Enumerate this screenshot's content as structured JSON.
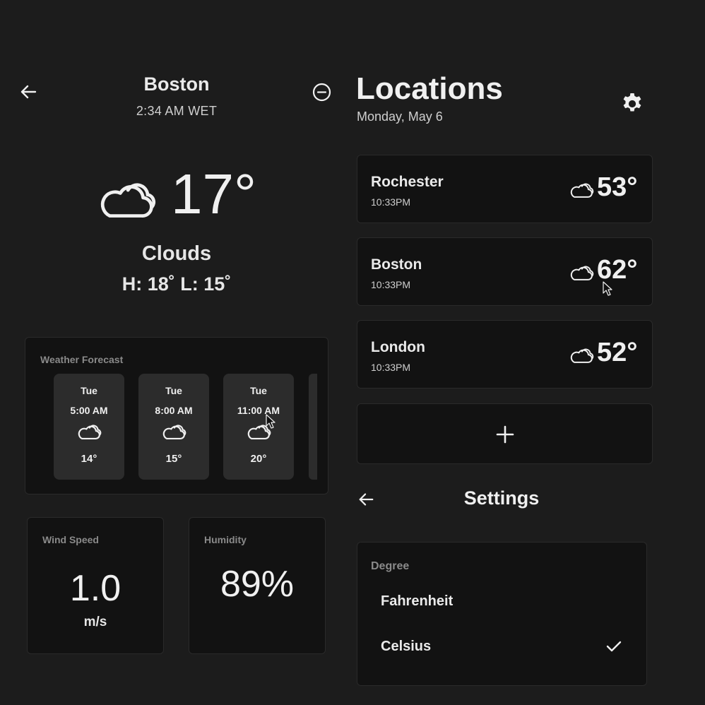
{
  "detail": {
    "city": "Boston",
    "local_time": "2:34 AM WET",
    "temperature": "17°",
    "condition": "Clouds",
    "high_low": "H: 18˚ L: 15˚",
    "condition_icon": "cloud-icon"
  },
  "forecast": {
    "label": "Weather Forecast",
    "items": [
      {
        "day": "Tue",
        "time": "5:00 AM",
        "icon": "cloud-icon",
        "temp": "14°"
      },
      {
        "day": "Tue",
        "time": "8:00 AM",
        "icon": "cloud-icon",
        "temp": "15°"
      },
      {
        "day": "Tue",
        "time": "11:00 AM",
        "icon": "cloud-icon",
        "temp": "20°"
      }
    ]
  },
  "wind": {
    "label": "Wind Speed",
    "value": "1.0",
    "unit": "m/s"
  },
  "humidity": {
    "label": "Humidity",
    "value": "89%"
  },
  "locations": {
    "title": "Locations",
    "date": "Monday, May 6",
    "items": [
      {
        "name": "Rochester",
        "time": "10:33PM",
        "temp": "53°",
        "icon": "cloud-icon"
      },
      {
        "name": "Boston",
        "time": "10:33PM",
        "temp": "62°",
        "icon": "cloud-icon"
      },
      {
        "name": "London",
        "time": "10:33PM",
        "temp": "52°",
        "icon": "cloud-icon"
      }
    ]
  },
  "settings": {
    "title": "Settings",
    "degree_label": "Degree",
    "options": [
      "Fahrenheit",
      "Celsius"
    ],
    "selected": "Celsius"
  },
  "colors": {
    "background": "#1c1c1c",
    "card": "#121212",
    "forecast_item": "#2c2c2c",
    "muted_label": "#8a8a8a",
    "text": "#f0f0f0"
  }
}
